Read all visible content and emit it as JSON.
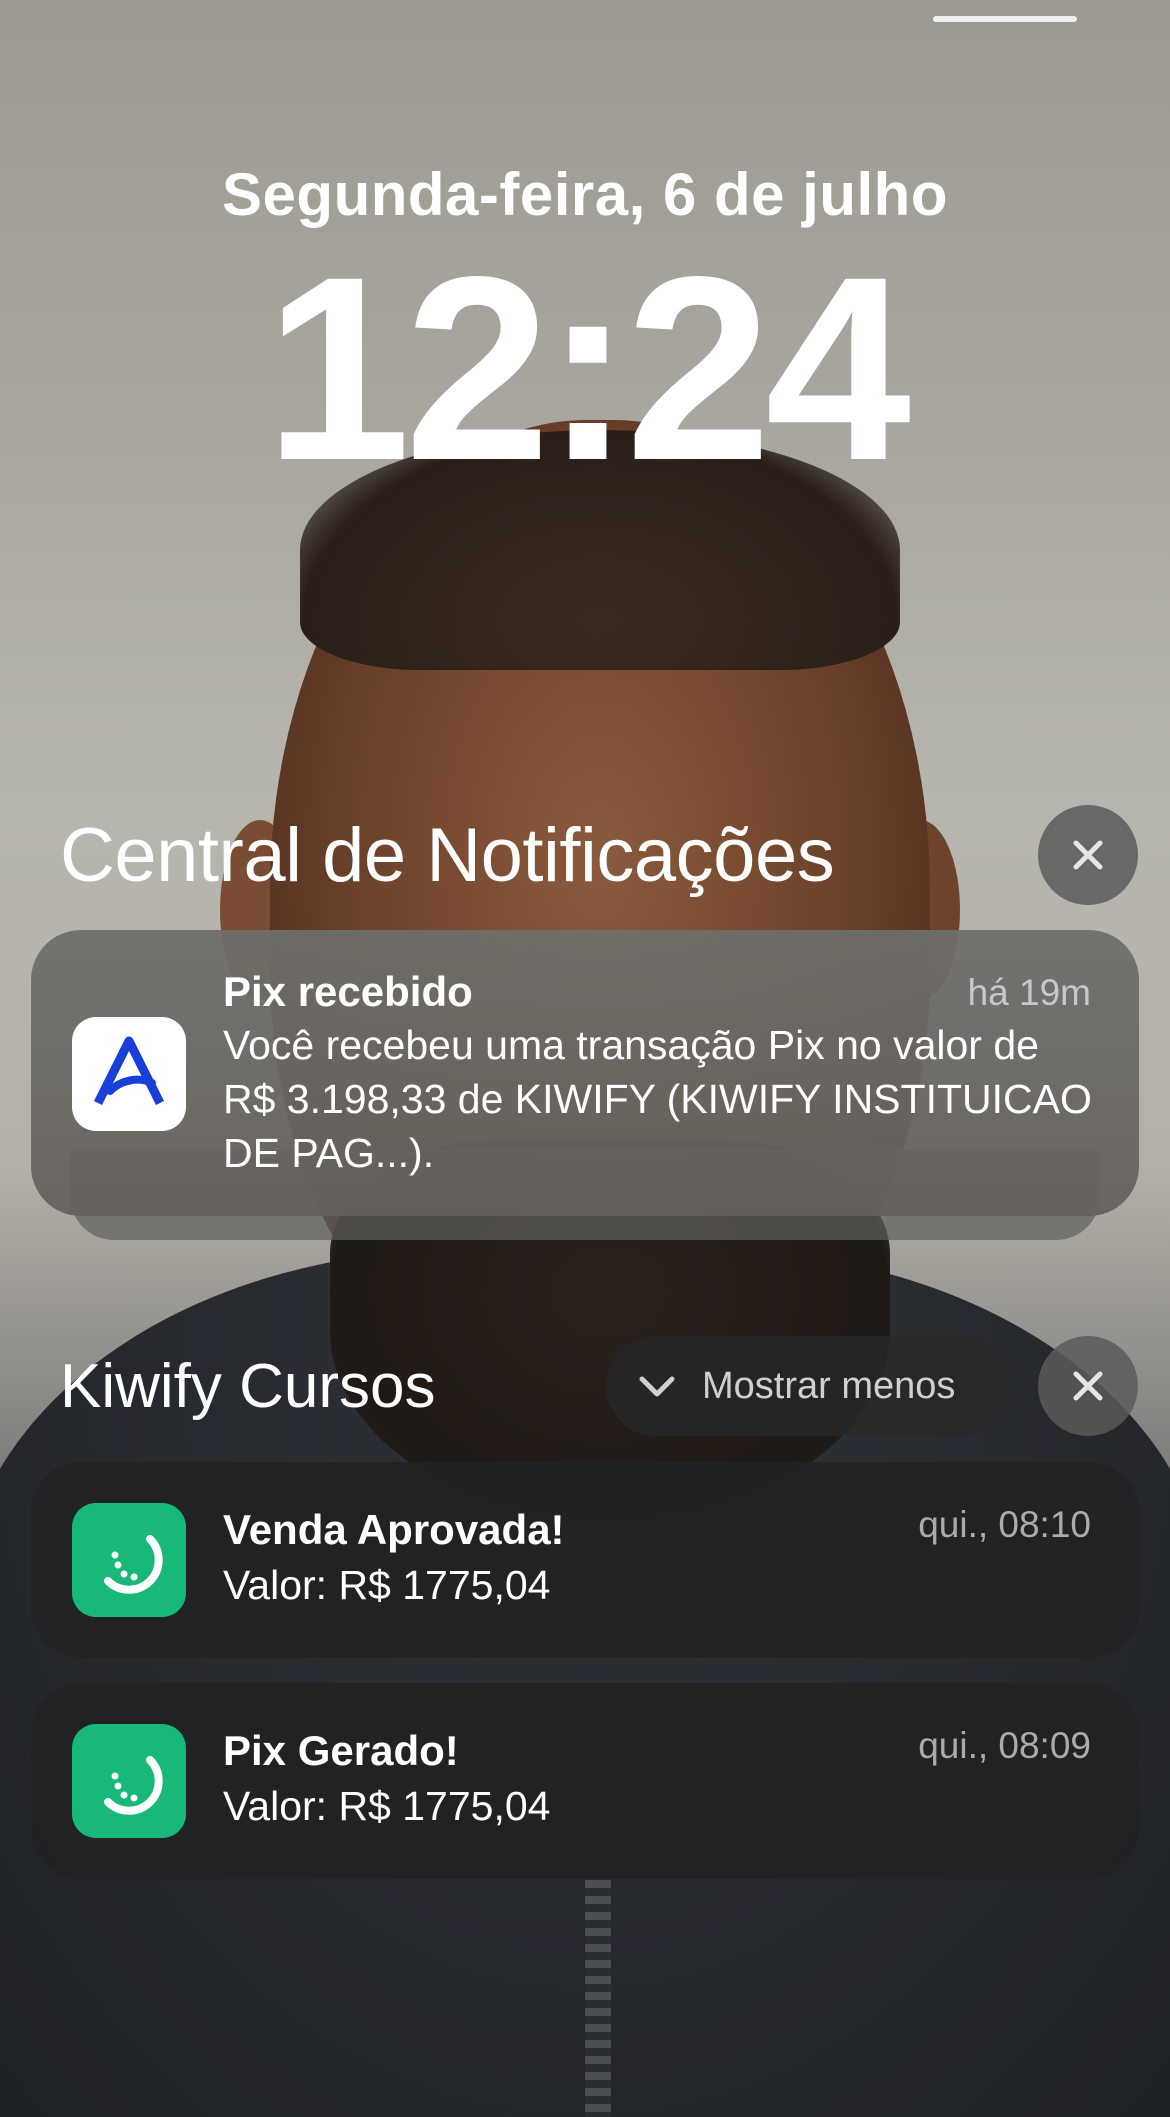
{
  "lockscreen": {
    "date": "Segunda-feira, 6 de julho",
    "time": "12:24"
  },
  "notification_center": {
    "title": "Central de Notificações",
    "close_icon": "close-icon"
  },
  "pix_notification": {
    "app_icon": "bank-a-logo-icon",
    "title": "Pix recebido",
    "time": "há 19m",
    "body": "Você recebeu uma transação Pix no valor de R$ 3.198,33 de KIWIFY (KIWIFY INSTITUICAO DE PAG...)."
  },
  "kiwify_group": {
    "title": "Kiwify Cursos",
    "show_less_label": "Mostrar menos",
    "show_less_icon": "chevron-down-icon",
    "close_icon": "close-icon",
    "accent_color": "#18b878",
    "notifications": [
      {
        "app_icon": "kiwi-logo-icon",
        "title": "Venda Aprovada!",
        "time": "qui., 08:10",
        "body": "Valor: R$ 1775,04"
      },
      {
        "app_icon": "kiwi-logo-icon",
        "title": "Pix Gerado!",
        "time": "qui., 08:09",
        "body": "Valor: R$ 1775,04"
      }
    ]
  }
}
